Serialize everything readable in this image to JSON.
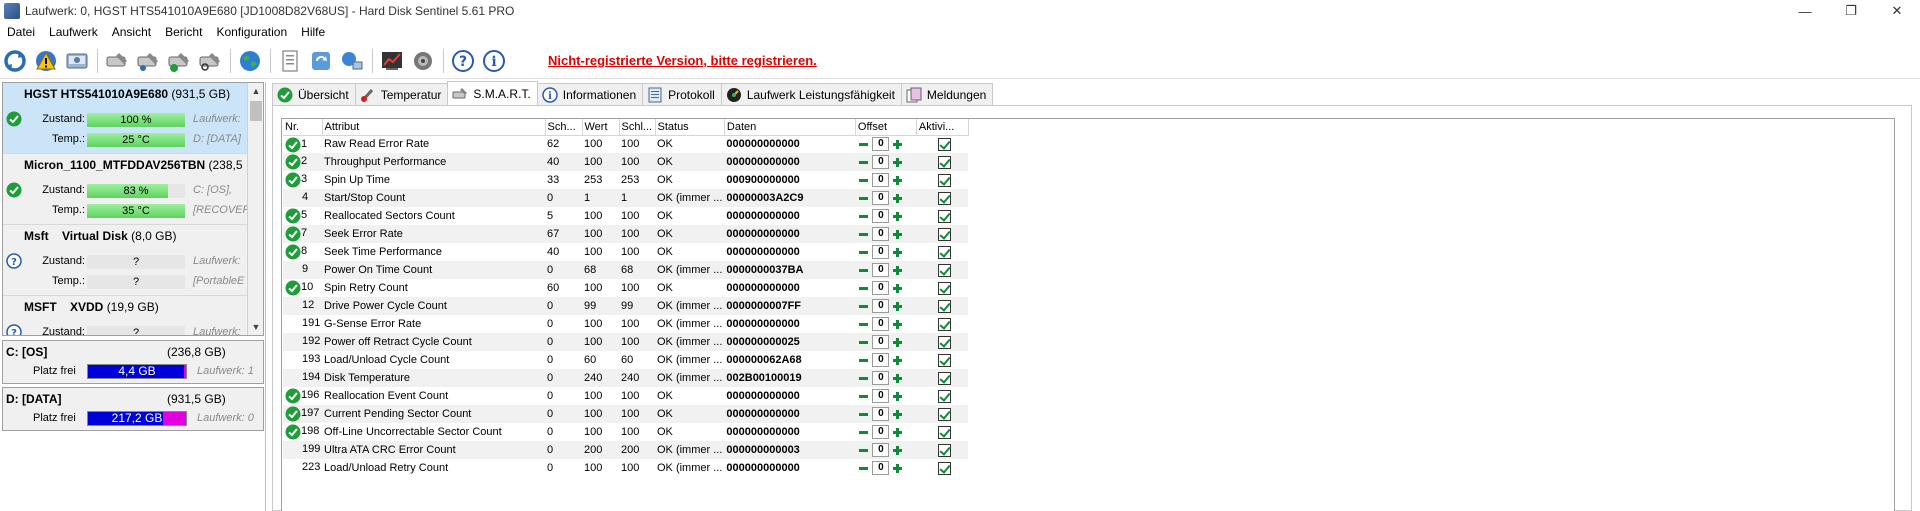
{
  "window": {
    "title": "Laufwerk: 0, HGST HTS541010A9E680 [JD1008D82V68US]  -  Hard Disk Sentinel 5.61 PRO",
    "minimize": "—",
    "restore": "❐",
    "close": "✕"
  },
  "menu": [
    "Datei",
    "Laufwerk",
    "Ansicht",
    "Bericht",
    "Konfiguration",
    "Hilfe"
  ],
  "toolbar": {
    "icons": [
      "refresh-icon",
      "warning-icon",
      "disk-icon",
      "wrench-icon",
      "wrench-cog-icon",
      "wrench-check-icon",
      "wrench-search-icon",
      "globe-icon",
      "report-icon",
      "sync-icon",
      "network-icon",
      "chart-icon",
      "speaker-icon",
      "help-icon",
      "info-icon"
    ],
    "register_link": "Nicht-registrierte Version, bitte registrieren."
  },
  "disks": [
    {
      "name": "HGST HTS541010A9E680",
      "size": "(931,5 GB)",
      "state_label": "Zustand:",
      "state": "100 %",
      "state_fill": 100,
      "temp_label": "Temp.:",
      "temp": "25 °C",
      "side1": "Laufwerk:",
      "side2": "D: [DATA]",
      "status": "ok"
    },
    {
      "name": "Micron_1100_MTFDDAV256TBN",
      "size": "(238,5",
      "state_label": "Zustand:",
      "state": "83 %",
      "state_fill": 83,
      "temp_label": "Temp.:",
      "temp": "35 °C",
      "side1": "C: [OS],",
      "side2": "[RECOVER",
      "status": "ok"
    },
    {
      "name": "Msft    Virtual Disk",
      "size": "(8,0 GB)",
      "state_label": "Zustand:",
      "state": "?",
      "state_fill": 0,
      "temp_label": "Temp.:",
      "temp": "?",
      "side1": "Laufwerk:",
      "side2": "[PortableE",
      "status": "unknown"
    },
    {
      "name": "MSFT    XVDD",
      "size": "(19,9 GB)",
      "state_label": "Zustand:",
      "state": "?",
      "state_fill": 0,
      "temp_label": "",
      "temp": "",
      "side1": "Laufwerk:",
      "side2": "",
      "status": "unknown"
    }
  ],
  "volumes": [
    {
      "name": "C: [OS]",
      "size": "(236,8 GB)",
      "free_label": "Platz frei",
      "free": "4,4 GB",
      "used_fraction": 0.98,
      "drive": "Laufwerk: 1"
    },
    {
      "name": "D: [DATA]",
      "size": "(931,5 GB)",
      "free_label": "Platz frei",
      "free": "217,2 GB",
      "used_fraction": 0.77,
      "drive": "Laufwerk: 0"
    }
  ],
  "tabs": [
    {
      "label": "Übersicht",
      "icon": "check-icon",
      "active": false
    },
    {
      "label": "Temperatur",
      "icon": "thermometer-icon",
      "active": false
    },
    {
      "label": "S.M.A.R.T.",
      "icon": "smart-icon",
      "active": true
    },
    {
      "label": "Informationen",
      "icon": "info-icon",
      "active": false
    },
    {
      "label": "Protokoll",
      "icon": "log-icon",
      "active": false
    },
    {
      "label": "Laufwerk Leistungsfähigkeit",
      "icon": "performance-icon",
      "active": false
    },
    {
      "label": "Meldungen",
      "icon": "messages-icon",
      "active": false
    }
  ],
  "smart": {
    "columns": [
      "Nr.",
      "Attribut",
      "Sch...",
      "Wert",
      "Schl...",
      "Status",
      "Daten",
      "Offset",
      "Aktivi..."
    ],
    "rows": [
      {
        "nr": "1",
        "attr": "Raw Read Error Rate",
        "sch": "62",
        "wert": "100",
        "schl": "100",
        "status": "OK",
        "daten": "000000000000",
        "offset": "0",
        "ok": true
      },
      {
        "nr": "2",
        "attr": "Throughput Performance",
        "sch": "40",
        "wert": "100",
        "schl": "100",
        "status": "OK",
        "daten": "000000000000",
        "offset": "0",
        "ok": true
      },
      {
        "nr": "3",
        "attr": "Spin Up Time",
        "sch": "33",
        "wert": "253",
        "schl": "253",
        "status": "OK",
        "daten": "000900000000",
        "offset": "0",
        "ok": true
      },
      {
        "nr": "4",
        "attr": "Start/Stop Count",
        "sch": "0",
        "wert": "1",
        "schl": "1",
        "status": "OK (immer ...",
        "daten": "00000003A2C9",
        "offset": "0",
        "ok": false
      },
      {
        "nr": "5",
        "attr": "Reallocated Sectors Count",
        "sch": "5",
        "wert": "100",
        "schl": "100",
        "status": "OK",
        "daten": "000000000000",
        "offset": "0",
        "ok": true
      },
      {
        "nr": "7",
        "attr": "Seek Error Rate",
        "sch": "67",
        "wert": "100",
        "schl": "100",
        "status": "OK",
        "daten": "000000000000",
        "offset": "0",
        "ok": true
      },
      {
        "nr": "8",
        "attr": "Seek Time Performance",
        "sch": "40",
        "wert": "100",
        "schl": "100",
        "status": "OK",
        "daten": "000000000000",
        "offset": "0",
        "ok": true
      },
      {
        "nr": "9",
        "attr": "Power On Time Count",
        "sch": "0",
        "wert": "68",
        "schl": "68",
        "status": "OK (immer ...",
        "daten": "0000000037BA",
        "offset": "0",
        "ok": false
      },
      {
        "nr": "10",
        "attr": "Spin Retry Count",
        "sch": "60",
        "wert": "100",
        "schl": "100",
        "status": "OK",
        "daten": "000000000000",
        "offset": "0",
        "ok": true
      },
      {
        "nr": "12",
        "attr": "Drive Power Cycle Count",
        "sch": "0",
        "wert": "99",
        "schl": "99",
        "status": "OK (immer ...",
        "daten": "0000000007FF",
        "offset": "0",
        "ok": false
      },
      {
        "nr": "191",
        "attr": "G-Sense Error Rate",
        "sch": "0",
        "wert": "100",
        "schl": "100",
        "status": "OK (immer ...",
        "daten": "000000000000",
        "offset": "0",
        "ok": false
      },
      {
        "nr": "192",
        "attr": "Power off Retract Cycle Count",
        "sch": "0",
        "wert": "100",
        "schl": "100",
        "status": "OK (immer ...",
        "daten": "000000000025",
        "offset": "0",
        "ok": false
      },
      {
        "nr": "193",
        "attr": "Load/Unload Cycle Count",
        "sch": "0",
        "wert": "60",
        "schl": "60",
        "status": "OK (immer ...",
        "daten": "000000062A68",
        "offset": "0",
        "ok": false
      },
      {
        "nr": "194",
        "attr": "Disk Temperature",
        "sch": "0",
        "wert": "240",
        "schl": "240",
        "status": "OK (immer ...",
        "daten": "002B00100019",
        "offset": "0",
        "ok": false
      },
      {
        "nr": "196",
        "attr": "Reallocation Event Count",
        "sch": "0",
        "wert": "100",
        "schl": "100",
        "status": "OK",
        "daten": "000000000000",
        "offset": "0",
        "ok": true
      },
      {
        "nr": "197",
        "attr": "Current Pending Sector Count",
        "sch": "0",
        "wert": "100",
        "schl": "100",
        "status": "OK",
        "daten": "000000000000",
        "offset": "0",
        "ok": true
      },
      {
        "nr": "198",
        "attr": "Off-Line Uncorrectable Sector Count",
        "sch": "0",
        "wert": "100",
        "schl": "100",
        "status": "OK",
        "daten": "000000000000",
        "offset": "0",
        "ok": true
      },
      {
        "nr": "199",
        "attr": "Ultra ATA CRC Error Count",
        "sch": "0",
        "wert": "200",
        "schl": "200",
        "status": "OK (immer ...",
        "daten": "000000000003",
        "offset": "0",
        "ok": false
      },
      {
        "nr": "223",
        "attr": "Load/Unload Retry Count",
        "sch": "0",
        "wert": "100",
        "schl": "100",
        "status": "OK (immer ...",
        "daten": "000000000000",
        "offset": "0",
        "ok": false
      }
    ]
  },
  "colors": {
    "ok_green": "#1f9d3a",
    "bar_green": "#6fdc6f",
    "free_blue": "#0000d8",
    "free_magenta": "#e000e0",
    "link_red": "#e00000"
  }
}
